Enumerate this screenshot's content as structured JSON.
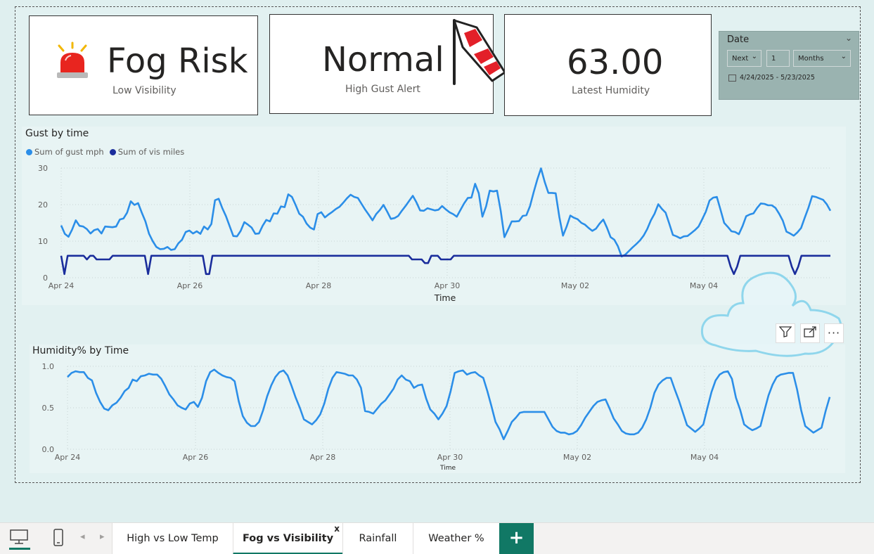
{
  "cards": {
    "fog": {
      "value": "Fog Risk",
      "label": "Low Visibility",
      "icon": "siren-icon"
    },
    "gust": {
      "value": "Normal",
      "label": "High Gust Alert",
      "icon": "windsock-icon"
    },
    "humidity": {
      "value": "63.00",
      "label": "Latest Humidity"
    }
  },
  "date_slicer": {
    "title": "Date",
    "mode": "Next",
    "count": "1",
    "unit": "Months",
    "range": "4/24/2025 - 5/23/2025"
  },
  "visual_header": {
    "icons": [
      "filter-icon",
      "focus-mode-icon",
      "more-options-icon"
    ]
  },
  "tabs": {
    "items": [
      "High vs Low Temp",
      "Fog vs Visibility",
      "Rainfall",
      "Weather %"
    ],
    "active": "Fog vs Visibility",
    "close": "x",
    "add": "+"
  },
  "colors": {
    "gust": "#2b8ee8",
    "vis": "#1a2d9c",
    "accent": "#117865"
  },
  "chart_data": [
    {
      "type": "line",
      "title": "Gust by time",
      "xlabel": "Time",
      "ylabel": "",
      "ylim": [
        0,
        30
      ],
      "yticks": [
        "0",
        "10",
        "20",
        "30"
      ],
      "xticks": [
        "Apr 24",
        "Apr 26",
        "Apr 28",
        "Apr 30",
        "May 02",
        "May 04"
      ],
      "grid": true,
      "legend": "top-left",
      "series": [
        {
          "name": "Sum of gust mph",
          "values": [
            14.3,
            12,
            11.2,
            13.2,
            15.7,
            14.2,
            14,
            13.3,
            12.1,
            13,
            13.3,
            12.1,
            14,
            13.9,
            13.8,
            14,
            15.9,
            16.2,
            17.8,
            20.9,
            19.9,
            20.4,
            17.8,
            15.4,
            12,
            10,
            8.4,
            7.8,
            7.9,
            8.4,
            7.6,
            7.8,
            9.4,
            10.4,
            12.5,
            12.9,
            12.1,
            12.7,
            12,
            14,
            13.2,
            14.7,
            21.2,
            21.6,
            19,
            16.8,
            14.1,
            11.4,
            11.3,
            12.8,
            15.2,
            14.5,
            13.7,
            12,
            12.1,
            14.2,
            15.8,
            15.4,
            17.6,
            17.5,
            19.5,
            19.3,
            22.8,
            22.1,
            19.9,
            17.5,
            16.7,
            14.8,
            13.7,
            13.2,
            17.4,
            17.9,
            16.5,
            17.3,
            18,
            18.8,
            19.4,
            20.5,
            21.7,
            22.7,
            22.1,
            21.8,
            20.2,
            18.6,
            17.2,
            15.7,
            17.4,
            18.5,
            19.9,
            18.1,
            16.1,
            16.3,
            16.9,
            18.3,
            19.6,
            21,
            22.4,
            20.6,
            18.4,
            18.3,
            19,
            18.7,
            18.4,
            18.6,
            19.6,
            18.7,
            17.9,
            17.4,
            16.7,
            18.5,
            20.3,
            21.8,
            21.9,
            25.7,
            23.1,
            16.7,
            19.5,
            23.8,
            23.6,
            23.8,
            18.3,
            11.1,
            13.2,
            15.4,
            15.4,
            15.5,
            16.9,
            17.1,
            19.6,
            23.4,
            26.9,
            29.9,
            26.2,
            23.2,
            23.2,
            23.1,
            16.6,
            11.5,
            14,
            17,
            16.4,
            16,
            15,
            14.5,
            13.6,
            12.8,
            13.4,
            14.8,
            15.9,
            13.7,
            11.1,
            10.4,
            8.6,
            5.8,
            6.3,
            7.3,
            8.3,
            9.2,
            10.2,
            11.5,
            13.3,
            15.7,
            17.5,
            20.1,
            18.8,
            17.8,
            14.8,
            11.7,
            11.3,
            10.8,
            11.3,
            11.4,
            12.2,
            13,
            14,
            16,
            18.1,
            21.1,
            21.9,
            22.1,
            18.6,
            15,
            13.9,
            12.7,
            12.5,
            11.9,
            14.1,
            16.8,
            17.3,
            17.6,
            19.1,
            20.3,
            20.2,
            19.8,
            19.8,
            19.1,
            17.5,
            15.6,
            12.6,
            12.1,
            11.5,
            12.4,
            13.6,
            16.4,
            19.1,
            22.3,
            22.1,
            21.7,
            21.3,
            20.1,
            18.3
          ]
        },
        {
          "name": "Sum of vis miles",
          "values": [
            6,
            1,
            6,
            6,
            6,
            6,
            6,
            6,
            5,
            6,
            6,
            5,
            5,
            5,
            5,
            5,
            6,
            6,
            6,
            6,
            6,
            6,
            6,
            6,
            6,
            6,
            6,
            1,
            6,
            6,
            6,
            6,
            6,
            6,
            6,
            6,
            6,
            6,
            6,
            6,
            6,
            6,
            6,
            6,
            6,
            1,
            1,
            6,
            6,
            6,
            6,
            6,
            6,
            6,
            6,
            6,
            6,
            6,
            6,
            6,
            6,
            6,
            6,
            6,
            6,
            6,
            6,
            6,
            6,
            6,
            6,
            6,
            6,
            6,
            6,
            6,
            6,
            6,
            6,
            6,
            6,
            6,
            6,
            6,
            6,
            6,
            6,
            6,
            6,
            6,
            6,
            6,
            6,
            6,
            6,
            6,
            6,
            6,
            6,
            6,
            6,
            6,
            6,
            6,
            6,
            6,
            6,
            6,
            6,
            5,
            5,
            5,
            5,
            4,
            4,
            6,
            6,
            6,
            5,
            5,
            5,
            5,
            6,
            6,
            6,
            6,
            6,
            6,
            6,
            6,
            6,
            6,
            6,
            6,
            6,
            6,
            6,
            6,
            6,
            6,
            6,
            6,
            6,
            6,
            6,
            6,
            6,
            6,
            6,
            6,
            6,
            6,
            6,
            6,
            6,
            6,
            6,
            6,
            6,
            6,
            6,
            6,
            6,
            6,
            6,
            6,
            6,
            6,
            6,
            6,
            6,
            6,
            6,
            6,
            6,
            6,
            6,
            6,
            6,
            6,
            6,
            6,
            6,
            6,
            6,
            6,
            6,
            6,
            6,
            6,
            6,
            6,
            6,
            6,
            6,
            6,
            6,
            6,
            6,
            6,
            6,
            6,
            6,
            6,
            6,
            6,
            6,
            6,
            3,
            1,
            3,
            6,
            6,
            6,
            6,
            6,
            6,
            6,
            6,
            6,
            6,
            6,
            6,
            6,
            6,
            6,
            6,
            3,
            1,
            3,
            6,
            6,
            6,
            6,
            6,
            6,
            6,
            6,
            6,
            6
          ]
        }
      ]
    },
    {
      "type": "line",
      "title": "Humidity% by Time",
      "xlabel": "Time",
      "ylabel": "",
      "ylim": [
        0,
        1
      ],
      "yticks": [
        "0.0",
        "0.5",
        "1.0"
      ],
      "xticks": [
        "Apr 24",
        "Apr 26",
        "Apr 28",
        "Apr 30",
        "May 02",
        "May 04"
      ],
      "grid": true,
      "series": [
        {
          "name": "",
          "values": [
            0.87,
            0.92,
            0.94,
            0.93,
            0.93,
            0.86,
            0.83,
            0.68,
            0.57,
            0.49,
            0.47,
            0.53,
            0.56,
            0.62,
            0.7,
            0.74,
            0.84,
            0.82,
            0.88,
            0.89,
            0.91,
            0.9,
            0.9,
            0.85,
            0.76,
            0.66,
            0.6,
            0.53,
            0.5,
            0.48,
            0.55,
            0.57,
            0.51,
            0.62,
            0.82,
            0.93,
            0.96,
            0.92,
            0.89,
            0.87,
            0.86,
            0.82,
            0.58,
            0.4,
            0.32,
            0.28,
            0.28,
            0.33,
            0.47,
            0.64,
            0.77,
            0.87,
            0.93,
            0.95,
            0.89,
            0.76,
            0.62,
            0.5,
            0.36,
            0.33,
            0.3,
            0.35,
            0.42,
            0.55,
            0.73,
            0.86,
            0.93,
            0.92,
            0.91,
            0.89,
            0.89,
            0.84,
            0.74,
            0.46,
            0.45,
            0.43,
            0.49,
            0.55,
            0.59,
            0.66,
            0.73,
            0.84,
            0.89,
            0.84,
            0.82,
            0.74,
            0.77,
            0.78,
            0.61,
            0.48,
            0.43,
            0.36,
            0.43,
            0.52,
            0.7,
            0.92,
            0.94,
            0.95,
            0.9,
            0.92,
            0.93,
            0.89,
            0.86,
            0.7,
            0.52,
            0.33,
            0.24,
            0.12,
            0.22,
            0.33,
            0.38,
            0.44,
            0.45,
            0.45,
            0.45,
            0.45,
            0.45,
            0.45,
            0.36,
            0.27,
            0.22,
            0.2,
            0.2,
            0.18,
            0.19,
            0.22,
            0.29,
            0.38,
            0.45,
            0.52,
            0.57,
            0.59,
            0.6,
            0.49,
            0.37,
            0.3,
            0.22,
            0.19,
            0.18,
            0.18,
            0.2,
            0.26,
            0.36,
            0.5,
            0.68,
            0.78,
            0.83,
            0.86,
            0.86,
            0.72,
            0.59,
            0.44,
            0.29,
            0.25,
            0.21,
            0.25,
            0.3,
            0.5,
            0.69,
            0.83,
            0.9,
            0.93,
            0.94,
            0.85,
            0.62,
            0.48,
            0.3,
            0.26,
            0.23,
            0.25,
            0.28,
            0.47,
            0.65,
            0.78,
            0.87,
            0.9,
            0.91,
            0.92,
            0.92,
            0.72,
            0.47,
            0.28,
            0.24,
            0.2,
            0.23,
            0.26,
            0.46,
            0.63
          ]
        }
      ]
    }
  ]
}
